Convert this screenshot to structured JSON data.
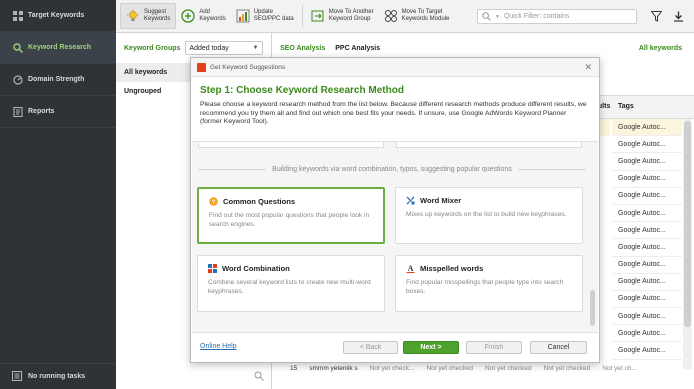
{
  "sidebar": {
    "items": [
      {
        "label": "Target Keywords",
        "icon": "grid-icon"
      },
      {
        "label": "Keyword Research",
        "icon": "search-icon"
      },
      {
        "label": "Domain Strength",
        "icon": "gauge-icon"
      },
      {
        "label": "Reports",
        "icon": "report-icon"
      }
    ],
    "status": "No running tasks",
    "accent": "#9fd37c"
  },
  "toolbar": {
    "suggest": "Suggest\nKeywords",
    "add": "Add\nKeywords",
    "update": "Update\nSEO/PPC data",
    "move_group": "Move To Another\nKeyword Group",
    "move_target": "Move To Target\nKeywords Module",
    "filter_placeholder": "Quick Filter: contains"
  },
  "groups": {
    "label": "Keyword Groups",
    "sort": "Added today",
    "items": [
      "All keywords",
      "Ungrouped"
    ]
  },
  "main": {
    "tabs": [
      "SEO Analysis",
      "PPC Analysis"
    ],
    "all_keywords": "All keywords",
    "col_results": "sults",
    "col_tags": "Tags",
    "tag_cells": [
      "Google Autoc...",
      "Google Autoc...",
      "Google Autoc...",
      "Google Autoc...",
      "Google Autoc...",
      "Google Autoc...",
      "Google Autoc...",
      "Google Autoc...",
      "Google Autoc...",
      "Google Autoc...",
      "Google Autoc...",
      "Google Autoc...",
      "Google Autoc...",
      "Google Autoc..."
    ],
    "bottom_row": {
      "num": "15",
      "keyword": "smmm yeteniik s",
      "c1": "Not yet check...",
      "c2": "Not yet checked",
      "c3": "Not yet checked",
      "c4": "Not yet checked",
      "c5": "Not yet ch..."
    }
  },
  "dialog": {
    "title": "Get Keyword Suggestions",
    "step": "Step 1: Choose Keyword Research Method",
    "description": "Please choose a keyword research method from the list below. Because different research methods produce different results, we recommend you try them all and find out which one best fits your needs. If unsure, use Google AdWords Keyword Planner (former Keyword Tool).",
    "section_label": "Building keywords via word combination, typos, suggesting popular questions",
    "cards": [
      {
        "title": "Common Questions",
        "desc": "Find out the most popular questions that people look in search engines.",
        "icon": "question-icon",
        "selected": true
      },
      {
        "title": "Word Mixer",
        "desc": "Mixes up keywords on the list to build new keyphrases.",
        "icon": "mixer-icon",
        "selected": false
      },
      {
        "title": "Word Combination",
        "desc": "Combine several keyword lists to create new multi-word keyphrases.",
        "icon": "combination-icon",
        "selected": false
      },
      {
        "title": "Misspelled words",
        "desc": "Find popular misspellings that people type into search boxes.",
        "icon": "misspell-icon",
        "selected": false
      }
    ],
    "help": "Online Help",
    "back": "< Back",
    "next": "Next >",
    "finish": "Finish",
    "cancel": "Cancel",
    "accent": "#3a8a1c"
  }
}
